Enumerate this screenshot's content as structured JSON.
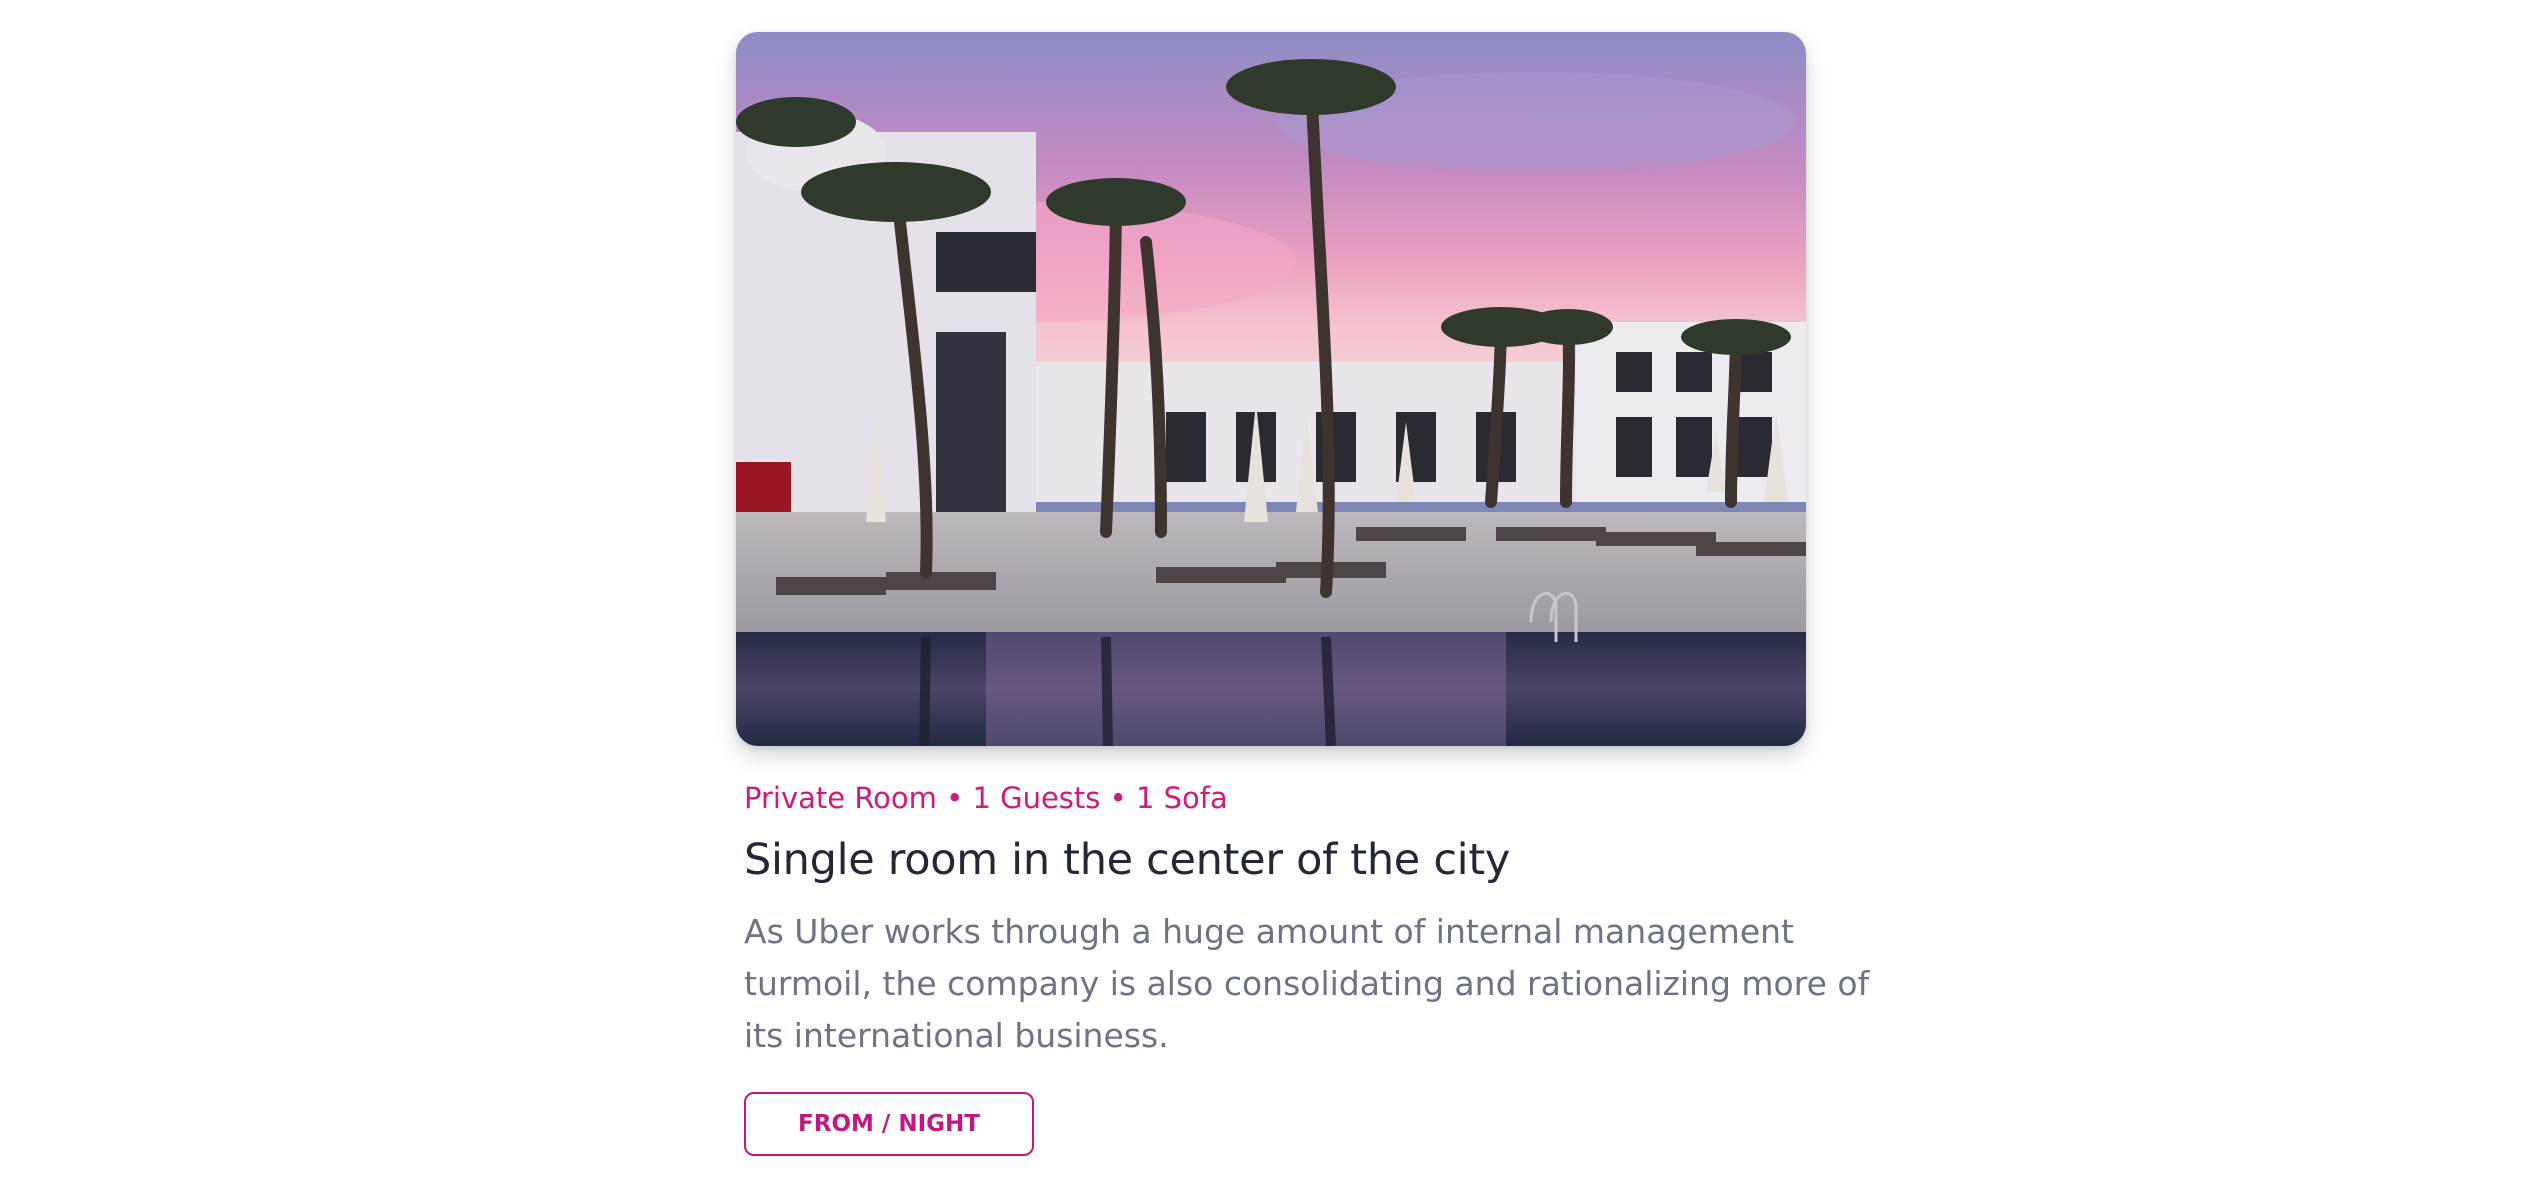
{
  "listing": {
    "meta": "Private Room • 1 Guests • 1 Sofa",
    "title": "Single room in the center of the city",
    "description_lines": [
      "As Uber works through a huge amount of internal management",
      "turmoil, the company is also consolidating and rationalizing more of",
      "its international business."
    ],
    "button_label": "FROM / NIGHT"
  },
  "colors": {
    "accent": "#c41680",
    "meta_text": "#d0197f",
    "title_text": "#232838",
    "body_text": "#6b7385"
  }
}
